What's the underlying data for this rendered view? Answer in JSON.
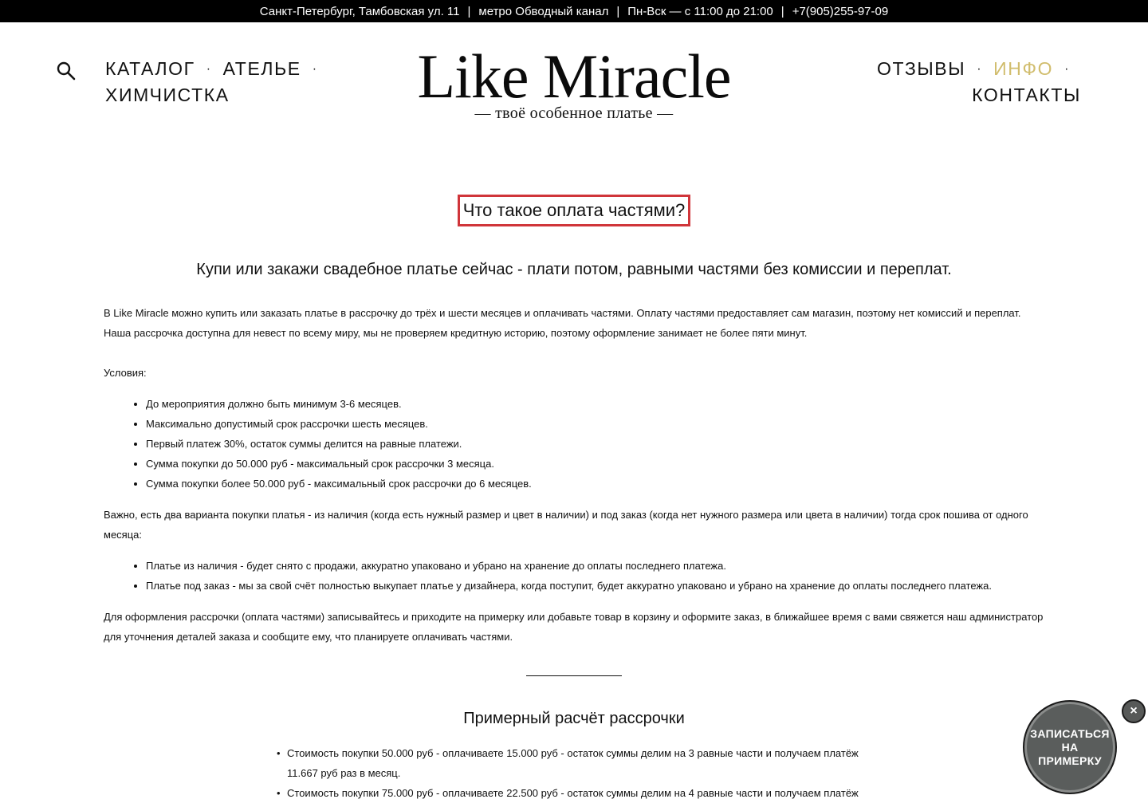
{
  "topbar": {
    "address": "Санкт-Петербург, Тамбовская ул. 11",
    "metro": "метро Обводный канал",
    "hours": "Пн-Вск — с 11:00 до 21:00",
    "phone": "+7(905)255-97-09",
    "separator": "|"
  },
  "nav": {
    "left": [
      "КАТАЛОГ",
      "АТЕЛЬЕ",
      "ХИМЧИСТКА"
    ],
    "right": [
      "ОТЗЫВЫ",
      "ИНФО",
      "КОНТАКТЫ"
    ],
    "dot": "·",
    "active": "ИНФО"
  },
  "logo": {
    "main": "Like Miracle",
    "sub": "— твоё особенное платье —"
  },
  "page": {
    "title": "Что такое оплата частями?",
    "lead": "Купи или закажи свадебное платье сейчас - плати потом, равными частями без комиссии и переплат.",
    "intro1": "В Like Miracle можно купить или заказать платье в рассрочку до трёх и шести месяцев и оплачивать частями. Оплату частями предоставляет сам магазин, поэтому нет комиссий и переплат.",
    "intro2": "Наша рассрочка доступна для невест по всему миру, мы не проверяем кредитную историю, поэтому оформление занимает не более пяти минут.",
    "conditions_label": "Условия:",
    "conditions": [
      "До мероприятия должно быть минимум 3-6 месяцев.",
      "Максимально допустимый срок рассрочки шесть месяцев.",
      "Первый платеж 30%, остаток суммы делится на равные платежи.",
      "Сумма покупки до 50.000 руб - максимальный срок рассрочки 3 месяца.",
      "Сумма покупки более 50.000 руб - максимальный срок рассрочки до 6 месяцев."
    ],
    "important": "Важно, есть два варианта покупки платья - из наличия (когда есть нужный размер и цвет в наличии) и под заказ (когда нет нужного размера или цвета в наличии) тогда срок пошива от одного месяца:",
    "variants": [
      "Платье из наличия - будет снято с продажи, аккуратно упаковано и убрано на хранение до оплаты последнего платежа.",
      "Платье под заказ - мы за свой счёт полностью выкупает платье у дизайнера, когда поступит, будет аккуратно упаковано и убрано на хранение до оплаты последнего платежа."
    ],
    "howto": "Для оформления рассрочки (оплата частями) записывайтесь и приходите на примерку или добавьте товар в корзину и оформите заказ, в ближайшее время с вами свяжется наш администратор для уточнения деталей заказа и сообщите ему, что планируете оплачивать частями.",
    "calc_title": "Примерный расчёт рассрочки",
    "calc": [
      "Стоимость покупки 50.000 руб - оплачиваете 15.000 руб - остаток суммы делим на 3 равные части и получаем платёж 11.667 руб раз в месяц.",
      "Стоимость покупки 75.000 руб - оплачиваете 22.500 руб - остаток суммы делим на 4 равные части и получаем платёж"
    ]
  },
  "cta": {
    "label": "ЗАПИСАТЬСЯ НА ПРИМЕРКУ",
    "close": "×"
  }
}
